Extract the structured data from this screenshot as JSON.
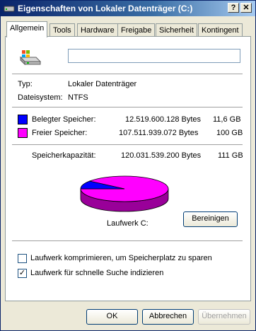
{
  "window": {
    "title": "Eigenschaften von Lokaler Datenträger (C:)",
    "title_buttons": [
      "?",
      "✕"
    ]
  },
  "tabs": [
    {
      "label": "Allgemein",
      "active": true
    },
    {
      "label": "Tools",
      "active": false
    },
    {
      "label": "Hardware",
      "active": false
    },
    {
      "label": "Freigabe",
      "active": false
    },
    {
      "label": "Sicherheit",
      "active": false
    },
    {
      "label": "Kontingent",
      "active": false
    }
  ],
  "general": {
    "drive_name_value": "",
    "type_label": "Typ:",
    "type_value": "Lokaler Datenträger",
    "fs_label": "Dateisystem:",
    "fs_value": "NTFS",
    "used": {
      "label": "Belegter Speicher:",
      "bytes": "12.519.600.128 Bytes",
      "size": "11,6 GB",
      "color": "#0000ff"
    },
    "free": {
      "label": "Freier Speicher:",
      "bytes": "107.511.939.072 Bytes",
      "size": "100 GB",
      "color": "#ff00ff"
    },
    "capacity": {
      "label": "Speicherkapazität:",
      "bytes": "120.031.539.200 Bytes",
      "size": "111 GB"
    },
    "used_fraction": 0.104,
    "drive_label": "Laufwerk C:",
    "cleanup_button": "Bereinigen",
    "compress_checkbox": {
      "label": "Laufwerk komprimieren, um Speicherplatz zu sparen",
      "checked": false
    },
    "index_checkbox": {
      "label": "Laufwerk für schnelle Suche indizieren",
      "checked": true
    }
  },
  "footer": {
    "ok": "OK",
    "cancel": "Abbrechen",
    "apply": "Übernehmen"
  },
  "icons": {
    "drive": "hard-drive-icon",
    "title": "hard-drive-icon"
  }
}
